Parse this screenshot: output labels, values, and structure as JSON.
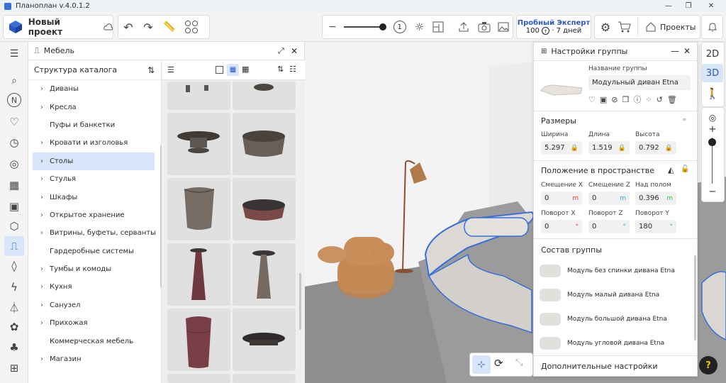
{
  "window": {
    "title": "Планоплан v.4.0.1.2",
    "minimize": "—",
    "maximize": "❐",
    "close": "✕"
  },
  "toolbar": {
    "project_name": "Новый проект",
    "trial_title": "Пробный Эксперт",
    "trial_value": "100",
    "trial_days": "· 7 дней",
    "projects_label": "Проекты",
    "step_number": "1"
  },
  "furniture_panel": {
    "title": "Мебель",
    "catalog_header": "Структура каталога",
    "categories": [
      {
        "label": "Диваны",
        "arrow": true
      },
      {
        "label": "Кресла",
        "arrow": true
      },
      {
        "label": "Пуфы и банкетки",
        "arrow": false
      },
      {
        "label": "Кровати и изголовья",
        "arrow": true
      },
      {
        "label": "Столы",
        "arrow": true,
        "selected": true
      },
      {
        "label": "Стулья",
        "arrow": true
      },
      {
        "label": "Шкафы",
        "arrow": true
      },
      {
        "label": "Открытое хранение",
        "arrow": true
      },
      {
        "label": "Витрины, буфеты, серванты",
        "arrow": true
      },
      {
        "label": "Гардеробные системы",
        "arrow": false
      },
      {
        "label": "Тумбы и комоды",
        "arrow": true
      },
      {
        "label": "Кухня",
        "arrow": true
      },
      {
        "label": "Санузел",
        "arrow": true
      },
      {
        "label": "Прихожая",
        "arrow": true
      },
      {
        "label": "Коммерческая мебель",
        "arrow": false
      },
      {
        "label": "Магазин",
        "arrow": true
      }
    ]
  },
  "group_panel": {
    "title": "Настройки группы",
    "name_label": "Название группы",
    "name_value": "Модульный диван Etna",
    "sizes": {
      "title": "Размеры",
      "width_label": "Ширина",
      "width_value": "5.297",
      "length_label": "Длина",
      "length_value": "1.519",
      "height_label": "Высота",
      "height_value": "0.792"
    },
    "position": {
      "title": "Положение в пространстве",
      "offset_x_label": "Смещение X",
      "offset_x_value": "0",
      "offset_x_unit": "m",
      "offset_z_label": "Смещение Z",
      "offset_z_value": "0",
      "offset_z_unit": "m",
      "above_floor_label": "Над полом",
      "above_floor_value": "0.396",
      "above_floor_unit": "m",
      "rot_x_label": "Поворот X",
      "rot_x_value": "0",
      "rot_x_unit": "°",
      "rot_z_label": "Поворот Z",
      "rot_z_value": "0",
      "rot_z_unit": "°",
      "rot_y_label": "Поворот Y",
      "rot_y_value": "180",
      "rot_y_unit": "°"
    },
    "composition": {
      "title": "Состав группы",
      "members": [
        "Модуль без спинки дивана Etna",
        "Модуль малый дивана Etna",
        "Модуль большой дивана Etna",
        "Модуль угловой дивана Etna"
      ]
    },
    "extra_title": "Дополнительные настройки"
  },
  "view": {
    "mode_2d": "2D",
    "mode_3d": "3D",
    "help": "?"
  },
  "colors": {
    "accent": "#3a6fd8",
    "selected_bg": "#d7e6f8",
    "trial": "#2a56c6",
    "unit_x": "#e03a3a",
    "unit_z": "#2aa7e0",
    "unit_y": "#3cc24a"
  }
}
